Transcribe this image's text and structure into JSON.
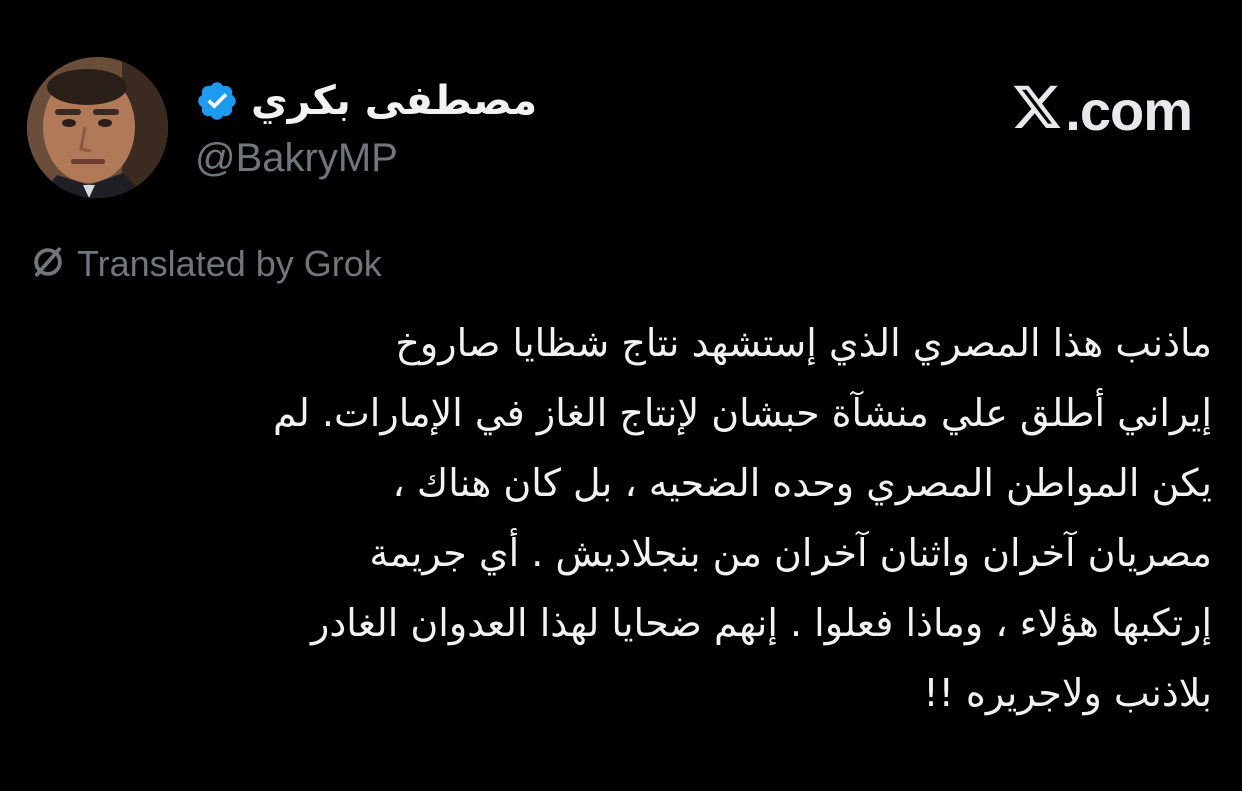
{
  "author": {
    "display_name": "مصطفى بكري",
    "handle": "@BakryMP",
    "verified": true,
    "verified_color": "#1d9bf0"
  },
  "brand": {
    "text": ".com",
    "icon": "x-logo-icon"
  },
  "translation": {
    "icon": "slashed-circle-icon",
    "label": "Translated by Grok"
  },
  "tweet": {
    "lines": [
      "ماذنب هذا المصري الذي إستشهد نتاج شظايا صاروخ",
      "إيراني أطلق علي منشآة حبشان لإنتاج الغاز في الإمارات. لم",
      "يكن المواطن المصري وحده الضحيه ، بل كان هناك ،",
      "مصريان آخران واثنان آخران من بنجلاديش . أي جريمة",
      "إرتكبها هؤلاء ، وماذا فعلوا . إنهم ضحايا لهذا العدوان الغادر",
      "بلاذنب ولاجريره !!"
    ]
  },
  "colors": {
    "background": "#000000",
    "text_primary": "#f2f2f2",
    "text_secondary": "#71767b"
  }
}
